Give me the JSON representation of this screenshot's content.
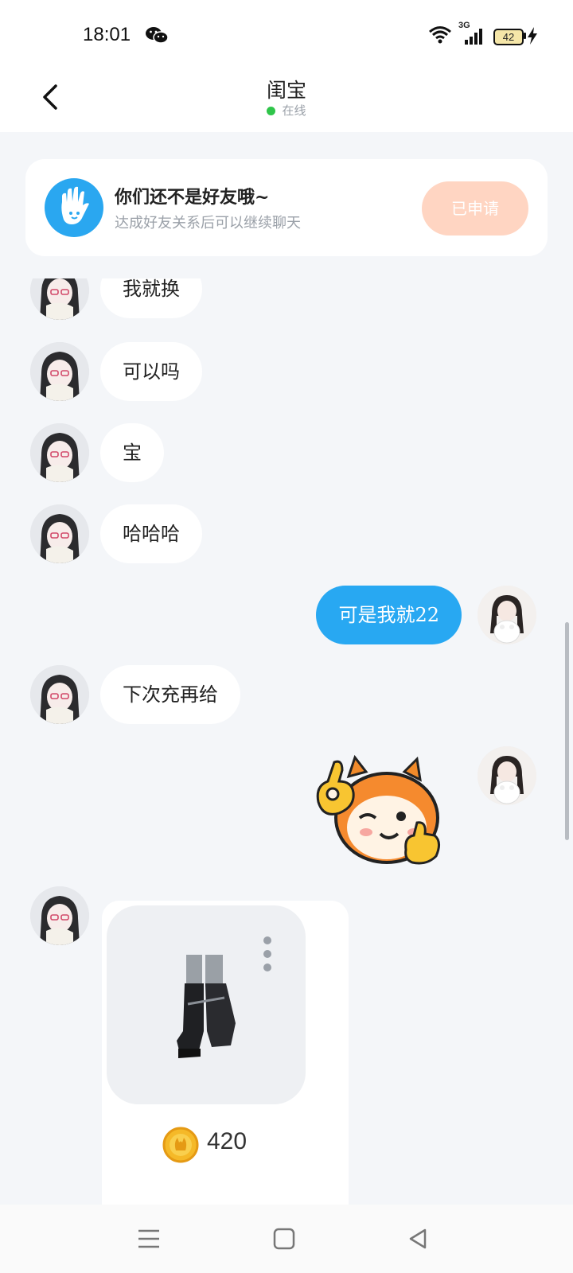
{
  "status_bar": {
    "time": "18:01",
    "network": "3G",
    "battery": "42"
  },
  "header": {
    "title": "闺宝",
    "status": "在线"
  },
  "friend_notice": {
    "title": "你们还不是好友哦~",
    "subtitle": "达成好友关系后可以继续聊天",
    "button_label": "已申请"
  },
  "messages": [
    {
      "side": "left",
      "text": "我就换"
    },
    {
      "side": "left",
      "text": "可以吗"
    },
    {
      "side": "left",
      "text": "宝"
    },
    {
      "side": "left",
      "text": "哈哈哈"
    },
    {
      "side": "right",
      "text": "可是我就22"
    },
    {
      "side": "left",
      "text": "下次充再给"
    }
  ],
  "product_card": {
    "price": "420"
  },
  "colors": {
    "accent_blue": "#28a8f2",
    "online_green": "#2fc54a",
    "applied_button_bg": "#ffd5c2"
  }
}
